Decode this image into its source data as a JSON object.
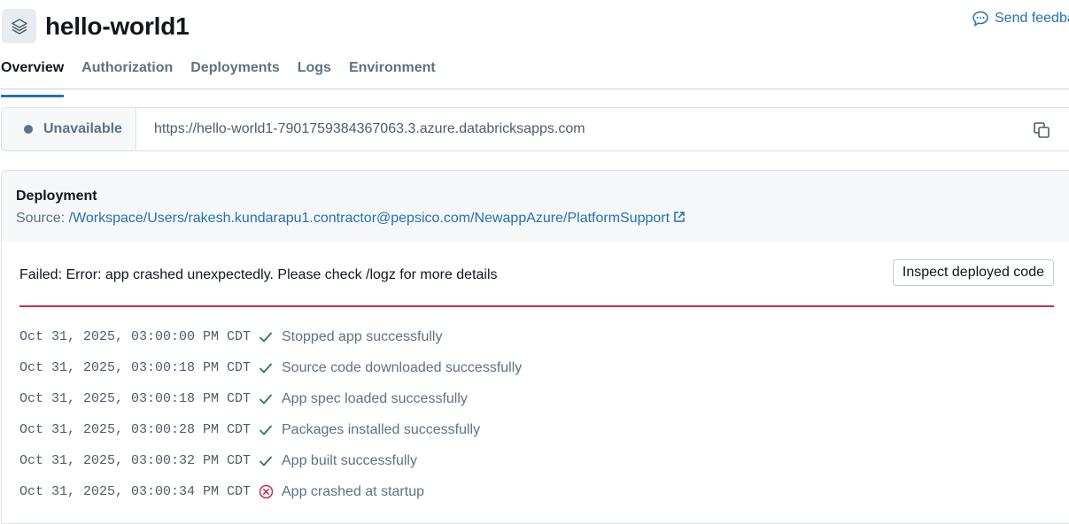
{
  "app": {
    "title": "hello-world1"
  },
  "feedback": {
    "label": "Send feedback"
  },
  "tabs": [
    {
      "label": "Overview",
      "active": true
    },
    {
      "label": "Authorization"
    },
    {
      "label": "Deployments"
    },
    {
      "label": "Logs"
    },
    {
      "label": "Environment"
    }
  ],
  "status": {
    "label": "Unavailable",
    "url": "https://hello-world1-7901759384367063.3.azure.databricksapps.com"
  },
  "deployment": {
    "title": "Deployment",
    "source_prefix": "Source: ",
    "source_path": "/Workspace/Users/rakesh.kundarapu1.contractor@pepsico.com/NewappAzure/PlatformSupport",
    "error": "Failed: Error: app crashed unexpectedly. Please check /logz for more details",
    "inspect_label": "Inspect deployed code",
    "logs": [
      {
        "time": "Oct 31, 2025, 03:00:00 PM CDT",
        "status": "success",
        "icon": "check-icon",
        "message": "Stopped app successfully"
      },
      {
        "time": "Oct 31, 2025, 03:00:18 PM CDT",
        "status": "success",
        "icon": "check-icon",
        "message": "Source code downloaded successfully"
      },
      {
        "time": "Oct 31, 2025, 03:00:18 PM CDT",
        "status": "success",
        "icon": "check-icon",
        "message": "App spec loaded successfully"
      },
      {
        "time": "Oct 31, 2025, 03:00:28 PM CDT",
        "status": "success",
        "icon": "check-icon",
        "message": "Packages installed successfully"
      },
      {
        "time": "Oct 31, 2025, 03:00:32 PM CDT",
        "status": "success",
        "icon": "check-icon",
        "message": "App built successfully"
      },
      {
        "time": "Oct 31, 2025, 03:00:34 PM CDT",
        "status": "error",
        "icon": "error-circle-icon",
        "message": "App crashed at startup"
      }
    ]
  },
  "colors": {
    "accent": "#2272b4",
    "success": "#277c43",
    "error": "#c82d4c"
  }
}
